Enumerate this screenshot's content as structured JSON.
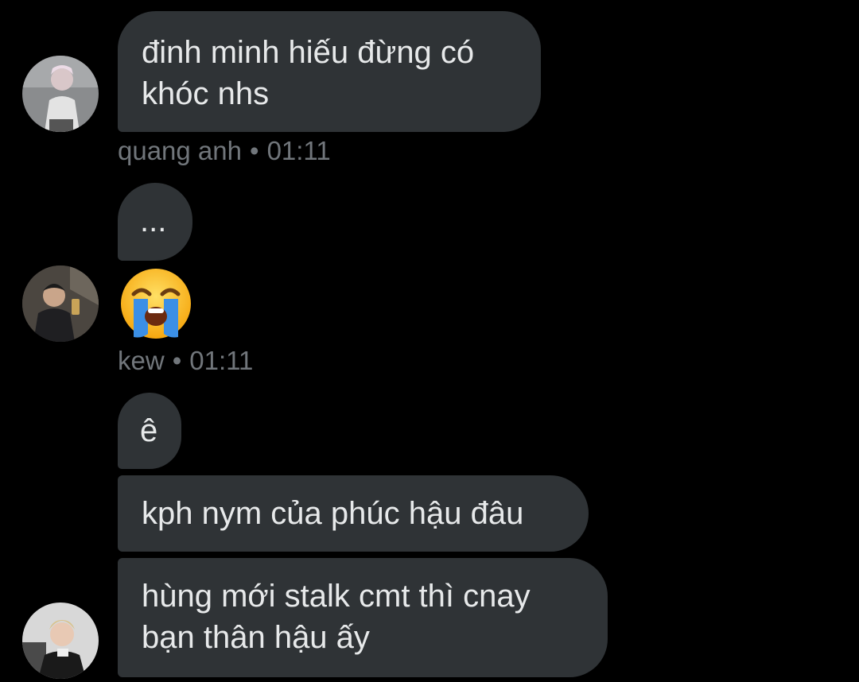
{
  "groups": [
    {
      "sender": "quang anh",
      "time": "01:11",
      "messages": [
        "đinh minh hiếu đừng có\nkhóc nhs"
      ]
    },
    {
      "sender": "kew",
      "time": "01:11",
      "messages": [
        "...",
        "😭"
      ]
    },
    {
      "messages": [
        "ê",
        "kph nym của phúc hậu đâu",
        "hùng mới stalk cmt thì cnay\nbạn thân hậu ấy"
      ]
    }
  ],
  "meta_separator": "•",
  "avatars": [
    {
      "icon": "avatar-quang-anh"
    },
    {
      "icon": "avatar-kew"
    },
    {
      "icon": "avatar-third-user"
    }
  ],
  "emoji": {
    "icon": "loudly-crying-face-icon"
  },
  "colors": {
    "background": "#000000",
    "bubble": "#2f3336",
    "text": "#e7e9ea",
    "meta": "#71767b"
  }
}
